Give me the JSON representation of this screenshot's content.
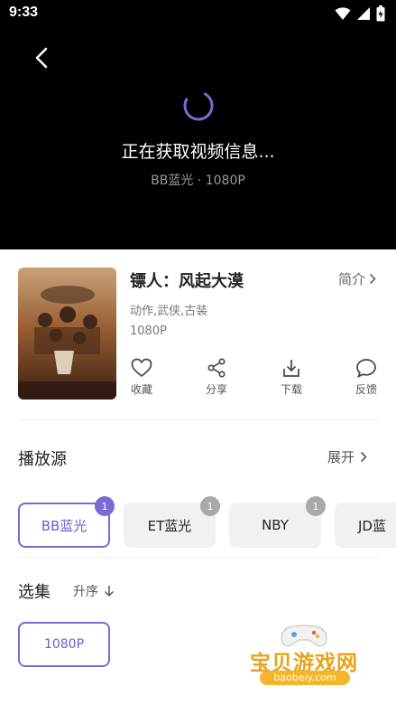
{
  "status_bar": {
    "time": "9:33"
  },
  "player": {
    "loading_text": "正在获取视频信息...",
    "loading_sub": "BB蓝光 · 1080P",
    "accent": "#7a6ad6"
  },
  "movie": {
    "title": "镖人：风起大漠",
    "intro_label": "简介",
    "tags": "动作,武侠,古装",
    "quality": "1080P"
  },
  "actions": [
    {
      "label": "收藏",
      "icon": "heart-icon"
    },
    {
      "label": "分享",
      "icon": "share-icon"
    },
    {
      "label": "下载",
      "icon": "download-icon"
    },
    {
      "label": "反馈",
      "icon": "feedback-icon"
    }
  ],
  "sources_section": {
    "title": "播放源",
    "expand_label": "展开",
    "sources": [
      {
        "label": "BB蓝光",
        "count": "1",
        "active": true
      },
      {
        "label": "ET蓝光",
        "count": "1",
        "active": false
      },
      {
        "label": "NBY",
        "count": "1",
        "active": false
      },
      {
        "label": "JD蓝",
        "count": "",
        "active": false
      }
    ]
  },
  "episodes_section": {
    "title": "选集",
    "sort_label": "升序",
    "episodes": [
      {
        "label": "1080P",
        "active": true
      }
    ]
  },
  "watermark": {
    "text": "宝贝游戏网",
    "url": "baobeiy.com"
  }
}
